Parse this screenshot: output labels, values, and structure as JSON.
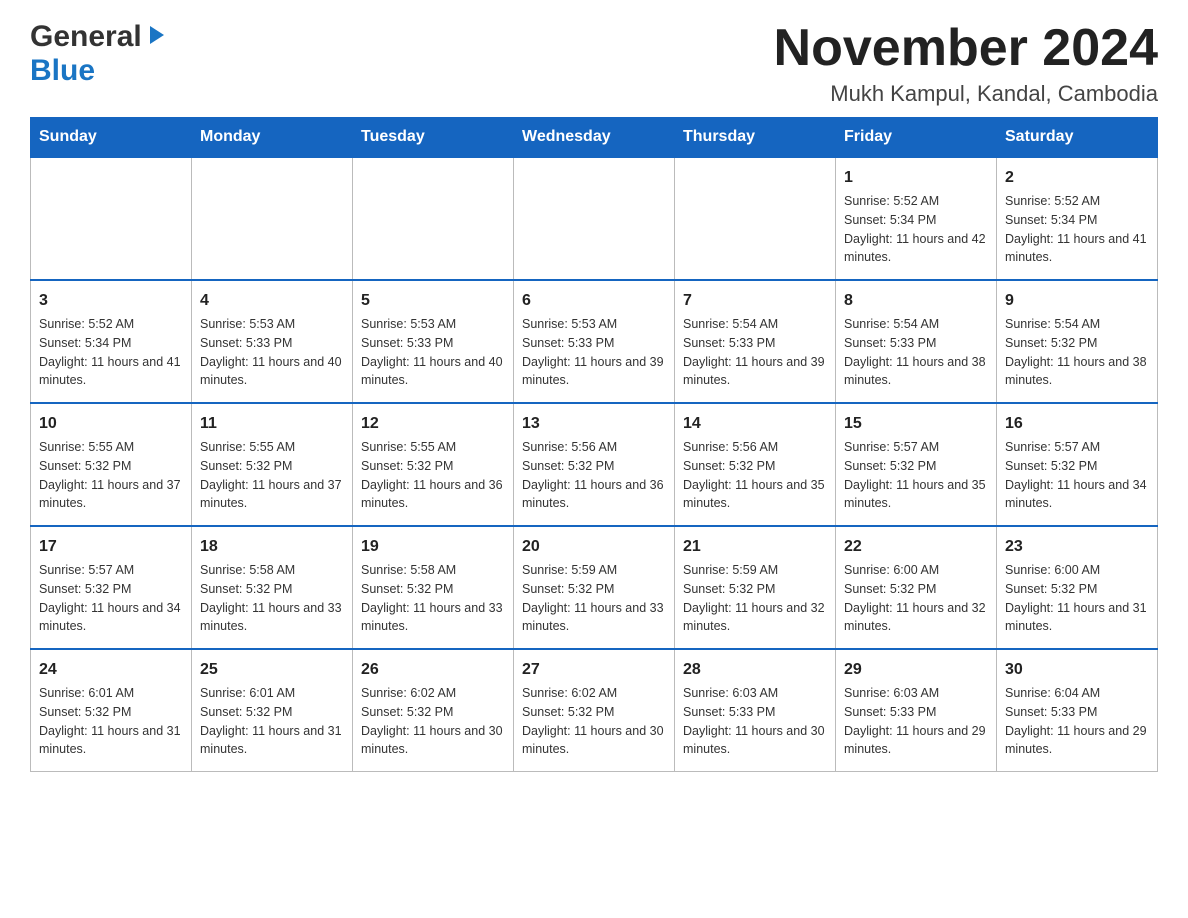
{
  "header": {
    "logo_general": "General",
    "logo_blue": "Blue",
    "month_title": "November 2024",
    "location": "Mukh Kampul, Kandal, Cambodia"
  },
  "days_of_week": [
    "Sunday",
    "Monday",
    "Tuesday",
    "Wednesday",
    "Thursday",
    "Friday",
    "Saturday"
  ],
  "weeks": [
    [
      {
        "day": "",
        "info": ""
      },
      {
        "day": "",
        "info": ""
      },
      {
        "day": "",
        "info": ""
      },
      {
        "day": "",
        "info": ""
      },
      {
        "day": "",
        "info": ""
      },
      {
        "day": "1",
        "info": "Sunrise: 5:52 AM\nSunset: 5:34 PM\nDaylight: 11 hours and 42 minutes."
      },
      {
        "day": "2",
        "info": "Sunrise: 5:52 AM\nSunset: 5:34 PM\nDaylight: 11 hours and 41 minutes."
      }
    ],
    [
      {
        "day": "3",
        "info": "Sunrise: 5:52 AM\nSunset: 5:34 PM\nDaylight: 11 hours and 41 minutes."
      },
      {
        "day": "4",
        "info": "Sunrise: 5:53 AM\nSunset: 5:33 PM\nDaylight: 11 hours and 40 minutes."
      },
      {
        "day": "5",
        "info": "Sunrise: 5:53 AM\nSunset: 5:33 PM\nDaylight: 11 hours and 40 minutes."
      },
      {
        "day": "6",
        "info": "Sunrise: 5:53 AM\nSunset: 5:33 PM\nDaylight: 11 hours and 39 minutes."
      },
      {
        "day": "7",
        "info": "Sunrise: 5:54 AM\nSunset: 5:33 PM\nDaylight: 11 hours and 39 minutes."
      },
      {
        "day": "8",
        "info": "Sunrise: 5:54 AM\nSunset: 5:33 PM\nDaylight: 11 hours and 38 minutes."
      },
      {
        "day": "9",
        "info": "Sunrise: 5:54 AM\nSunset: 5:32 PM\nDaylight: 11 hours and 38 minutes."
      }
    ],
    [
      {
        "day": "10",
        "info": "Sunrise: 5:55 AM\nSunset: 5:32 PM\nDaylight: 11 hours and 37 minutes."
      },
      {
        "day": "11",
        "info": "Sunrise: 5:55 AM\nSunset: 5:32 PM\nDaylight: 11 hours and 37 minutes."
      },
      {
        "day": "12",
        "info": "Sunrise: 5:55 AM\nSunset: 5:32 PM\nDaylight: 11 hours and 36 minutes."
      },
      {
        "day": "13",
        "info": "Sunrise: 5:56 AM\nSunset: 5:32 PM\nDaylight: 11 hours and 36 minutes."
      },
      {
        "day": "14",
        "info": "Sunrise: 5:56 AM\nSunset: 5:32 PM\nDaylight: 11 hours and 35 minutes."
      },
      {
        "day": "15",
        "info": "Sunrise: 5:57 AM\nSunset: 5:32 PM\nDaylight: 11 hours and 35 minutes."
      },
      {
        "day": "16",
        "info": "Sunrise: 5:57 AM\nSunset: 5:32 PM\nDaylight: 11 hours and 34 minutes."
      }
    ],
    [
      {
        "day": "17",
        "info": "Sunrise: 5:57 AM\nSunset: 5:32 PM\nDaylight: 11 hours and 34 minutes."
      },
      {
        "day": "18",
        "info": "Sunrise: 5:58 AM\nSunset: 5:32 PM\nDaylight: 11 hours and 33 minutes."
      },
      {
        "day": "19",
        "info": "Sunrise: 5:58 AM\nSunset: 5:32 PM\nDaylight: 11 hours and 33 minutes."
      },
      {
        "day": "20",
        "info": "Sunrise: 5:59 AM\nSunset: 5:32 PM\nDaylight: 11 hours and 33 minutes."
      },
      {
        "day": "21",
        "info": "Sunrise: 5:59 AM\nSunset: 5:32 PM\nDaylight: 11 hours and 32 minutes."
      },
      {
        "day": "22",
        "info": "Sunrise: 6:00 AM\nSunset: 5:32 PM\nDaylight: 11 hours and 32 minutes."
      },
      {
        "day": "23",
        "info": "Sunrise: 6:00 AM\nSunset: 5:32 PM\nDaylight: 11 hours and 31 minutes."
      }
    ],
    [
      {
        "day": "24",
        "info": "Sunrise: 6:01 AM\nSunset: 5:32 PM\nDaylight: 11 hours and 31 minutes."
      },
      {
        "day": "25",
        "info": "Sunrise: 6:01 AM\nSunset: 5:32 PM\nDaylight: 11 hours and 31 minutes."
      },
      {
        "day": "26",
        "info": "Sunrise: 6:02 AM\nSunset: 5:32 PM\nDaylight: 11 hours and 30 minutes."
      },
      {
        "day": "27",
        "info": "Sunrise: 6:02 AM\nSunset: 5:32 PM\nDaylight: 11 hours and 30 minutes."
      },
      {
        "day": "28",
        "info": "Sunrise: 6:03 AM\nSunset: 5:33 PM\nDaylight: 11 hours and 30 minutes."
      },
      {
        "day": "29",
        "info": "Sunrise: 6:03 AM\nSunset: 5:33 PM\nDaylight: 11 hours and 29 minutes."
      },
      {
        "day": "30",
        "info": "Sunrise: 6:04 AM\nSunset: 5:33 PM\nDaylight: 11 hours and 29 minutes."
      }
    ]
  ]
}
